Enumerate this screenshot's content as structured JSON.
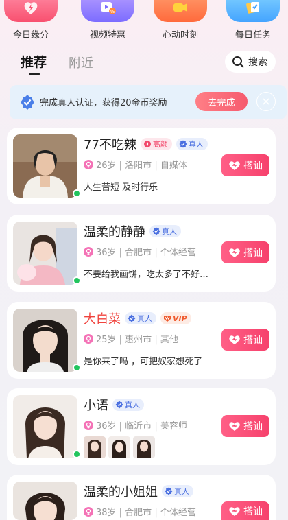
{
  "quick_entries": [
    {
      "label": "今日缘分",
      "icon": "heart-lightning-icon"
    },
    {
      "label": "视频特惠",
      "icon": "video-discount-icon"
    },
    {
      "label": "心动时刻",
      "icon": "video-camera-icon"
    },
    {
      "label": "每日任务",
      "icon": "task-cards-icon"
    }
  ],
  "tabs": {
    "active": "推荐",
    "inactive": "附近"
  },
  "search": {
    "label": "搜索"
  },
  "verify_banner": {
    "text": "完成真人认证，获得20金币奖励",
    "button": "去完成"
  },
  "tags": {
    "hot": "高颜",
    "real": "真人",
    "vip": "VIP"
  },
  "chat_label": "搭讪",
  "users": [
    {
      "name": "77不吃辣",
      "info": "26岁 | 洛阳市 | 自媒体",
      "bio": "人生苦短 及时行乐",
      "hot": true,
      "real": true,
      "vip": false
    },
    {
      "name": "温柔的静静",
      "info": "36岁 | 合肥市 | 个体经营",
      "bio": "不要给我画饼，吃太多了不好…",
      "hot": false,
      "real": true,
      "vip": false
    },
    {
      "name": "大白菜",
      "info": "25岁 | 惠州市 | 其他",
      "bio": "是你来了吗 ，可把奴家想死了",
      "hot": false,
      "real": true,
      "vip": true
    },
    {
      "name": "小语",
      "info": "36岁 | 临沂市 | 美容师",
      "bio": "",
      "hot": false,
      "real": true,
      "vip": false
    },
    {
      "name": "温柔的小姐姐",
      "info": "38岁 | 合肥市 | 个体经营",
      "bio": "",
      "hot": false,
      "real": true,
      "vip": false
    }
  ],
  "colors": {
    "accent": "#f6416c",
    "online": "#22c55e",
    "real_tag": "#4a6fe0"
  }
}
